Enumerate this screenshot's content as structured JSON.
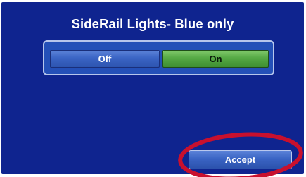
{
  "dialog": {
    "title": "SideRail Lights- Blue only"
  },
  "toggle": {
    "off_label": "Off",
    "on_label": "On",
    "selected": "On"
  },
  "actions": {
    "accept_label": "Accept"
  },
  "colors": {
    "background": "#0f248f",
    "group_fill": "#2450b8",
    "button_blue": "#3a64c4",
    "button_green": "#55a844",
    "highlight": "#c8102e"
  }
}
